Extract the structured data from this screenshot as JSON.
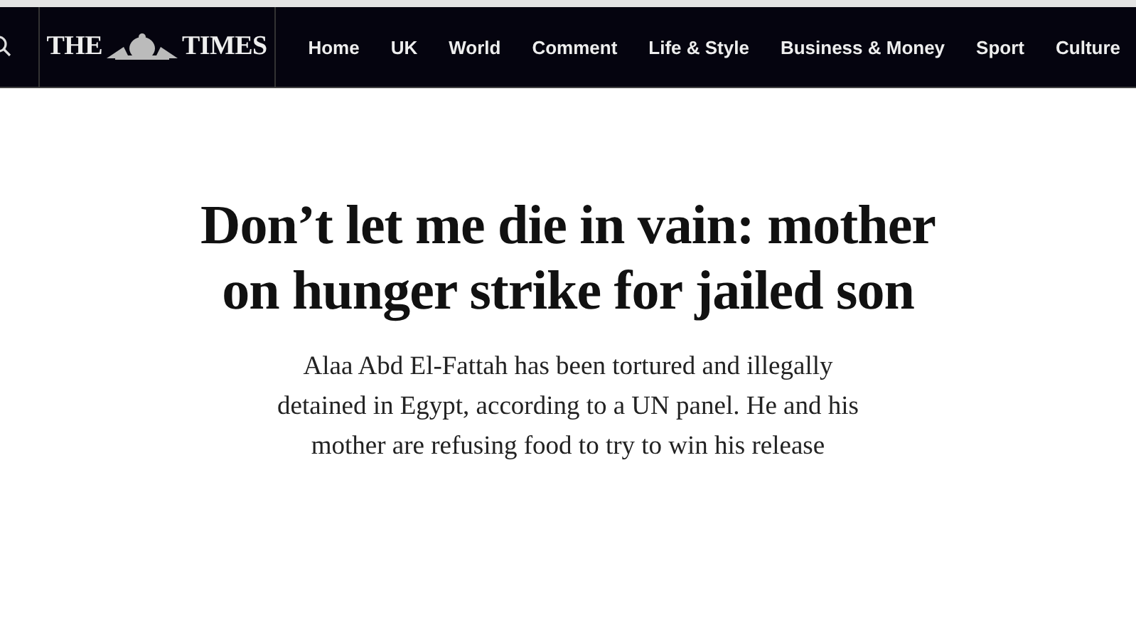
{
  "masthead": {
    "logo_left": "THE",
    "logo_right": "TIMES"
  },
  "nav": [
    {
      "label": "Home"
    },
    {
      "label": "UK"
    },
    {
      "label": "World"
    },
    {
      "label": "Comment"
    },
    {
      "label": "Life & Style"
    },
    {
      "label": "Business & Money"
    },
    {
      "label": "Sport"
    },
    {
      "label": "Culture"
    }
  ],
  "article": {
    "headline": "Don’t let me die in vain: mother on hunger strike for jailed son",
    "standfirst": "Alaa Abd El-Fattah has been tortured and illegally detained in Egypt, according to a UN panel. He and his mother are refusing food to try to win his release"
  }
}
